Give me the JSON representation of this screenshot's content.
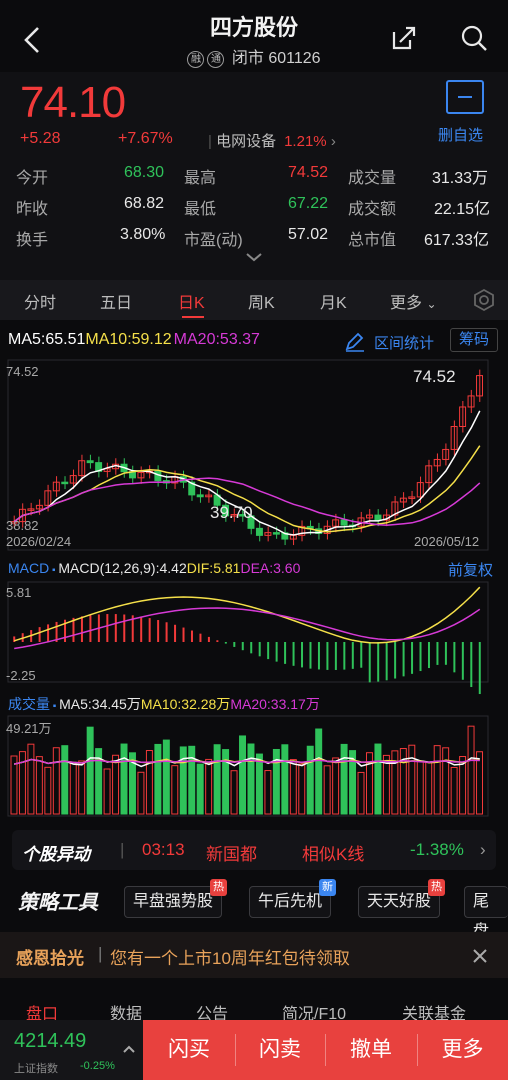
{
  "header": {
    "title": "四方股份",
    "tag1": "融",
    "tag2": "通",
    "status": "闭市 601126"
  },
  "quote": {
    "price": "74.10",
    "change": "+5.28",
    "change_pct": "+7.67%",
    "sector": "电网设备",
    "sector_pct": "1.21%",
    "remove_label": "删自选",
    "stats": [
      {
        "label": "今开",
        "value": "68.30",
        "color": "#2fc25a"
      },
      {
        "label": "最高",
        "value": "74.52",
        "color": "#f23a3a"
      },
      {
        "label": "成交量",
        "value": "31.33万",
        "color": "#e8e8e8"
      },
      {
        "label": "昨收",
        "value": "68.82",
        "color": "#e8e8e8"
      },
      {
        "label": "最低",
        "value": "67.22",
        "color": "#2fc25a"
      },
      {
        "label": "成交额",
        "value": "22.15亿",
        "color": "#e8e8e8"
      },
      {
        "label": "换手",
        "value": "3.80%",
        "color": "#e8e8e8"
      },
      {
        "label": "市盈(动)",
        "value": "57.02",
        "color": "#e8e8e8"
      },
      {
        "label": "总市值",
        "value": "617.33亿",
        "color": "#e8e8e8"
      }
    ]
  },
  "tabs": {
    "items": [
      "分时",
      "五日",
      "日K",
      "周K",
      "月K",
      "更多"
    ],
    "active": "日K"
  },
  "chart": {
    "ma5": "MA5:65.51",
    "ma10": "MA10:59.12",
    "ma20": "MA20:53.37",
    "range_stat": "区间统计",
    "chips": "筹码",
    "price_top": "74.52",
    "price_bottom": "38.82",
    "high_mark": "74.52",
    "low_mark": "39.70",
    "date_start": "2026/02/24",
    "date_end": "2026/05/12",
    "macd_name": "MACD",
    "macd_params": "MACD(12,26,9):4.42",
    "dif": "DIF:5.81",
    "dea": "DEA:3.60",
    "adjust": "前复权",
    "macd_top": "5.81",
    "macd_bottom": "-2.25",
    "vol_name": "成交量",
    "vol_ma5": "MA5:34.45万",
    "vol_ma10": "MA10:32.28万",
    "vol_ma20": "MA20:33.17万",
    "vol_top": "49.21万",
    "colors": {
      "up": "#f23a3a",
      "down": "#2fc25a",
      "ma5": "#ffffff",
      "ma10": "#f5e04a",
      "ma20": "#d63ad6"
    }
  },
  "movement": {
    "title": "个股异动",
    "time": "03:13",
    "event": "新国都",
    "similar": "相似K线",
    "pct": "-1.38%"
  },
  "tools": {
    "title": "策略工具",
    "chips": [
      {
        "label": "早盘强势股",
        "badge": "热",
        "badge_color": "#e8413e"
      },
      {
        "label": "午后先机",
        "badge": "新",
        "badge_color": "#3b86f0"
      },
      {
        "label": "天天好股",
        "badge": "热",
        "badge_color": "#e8413e"
      },
      {
        "label": "尾盘",
        "badge": "",
        "badge_color": ""
      }
    ]
  },
  "promo": {
    "title": "感恩拾光",
    "text": "您有一个上市10周年红包待领取"
  },
  "bottom_tabs": [
    "盘口",
    "数据",
    "公告",
    "简况/F10",
    "关联基金"
  ],
  "footer": {
    "index_value": "4214.49",
    "index_name": "上证指数",
    "index_pct": "-0.25%",
    "actions": [
      "闪买",
      "闪卖",
      "撤单",
      "更多"
    ]
  }
}
